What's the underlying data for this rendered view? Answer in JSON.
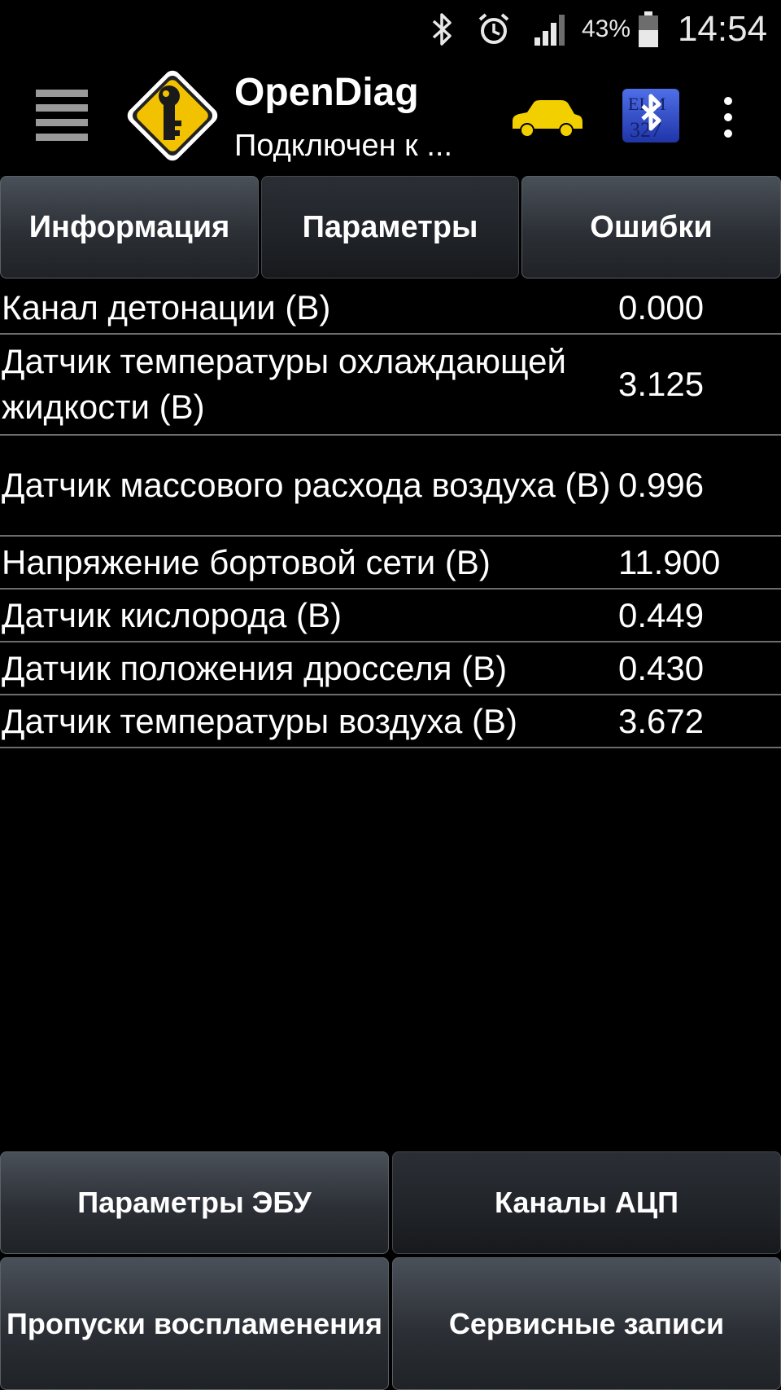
{
  "status_bar": {
    "battery_percent": "43%",
    "time": "14:54",
    "icons": [
      "bluetooth-icon",
      "alarm-icon",
      "signal-icon",
      "battery-icon"
    ]
  },
  "action_bar": {
    "title": "OpenDiag",
    "subtitle": "Подключен к ...",
    "logo_text": "ELM 327",
    "colors": {
      "logo_yellow": "#f2c200",
      "car_yellow": "#f2d000",
      "bt_blue": "#2f4fd0"
    }
  },
  "tabs": [
    {
      "label": "Информация",
      "active": false
    },
    {
      "label": "Параметры",
      "active": true
    },
    {
      "label": "Ошибки",
      "active": false
    }
  ],
  "parameters": [
    {
      "name": "Канал детонации (В)",
      "value": "0.000"
    },
    {
      "name": "Датчик температуры охлаждающей жидкости (В)",
      "value": "3.125"
    },
    {
      "name": "Датчик массового расхода воздуха (В)",
      "value": "0.996"
    },
    {
      "name": "Напряжение бортовой сети (В)",
      "value": "11.900"
    },
    {
      "name": "Датчик кислорода (В)",
      "value": "0.449"
    },
    {
      "name": "Датчик положения дросселя (В)",
      "value": "0.430"
    },
    {
      "name": "Датчик температуры воздуха (В)",
      "value": "3.672"
    }
  ],
  "bottom_buttons": [
    {
      "label": "Параметры ЭБУ",
      "active": false
    },
    {
      "label": "Каналы АЦП",
      "active": true
    },
    {
      "label": "Пропуски воспламенения",
      "active": false
    },
    {
      "label": "Сервисные записи",
      "active": false
    }
  ]
}
